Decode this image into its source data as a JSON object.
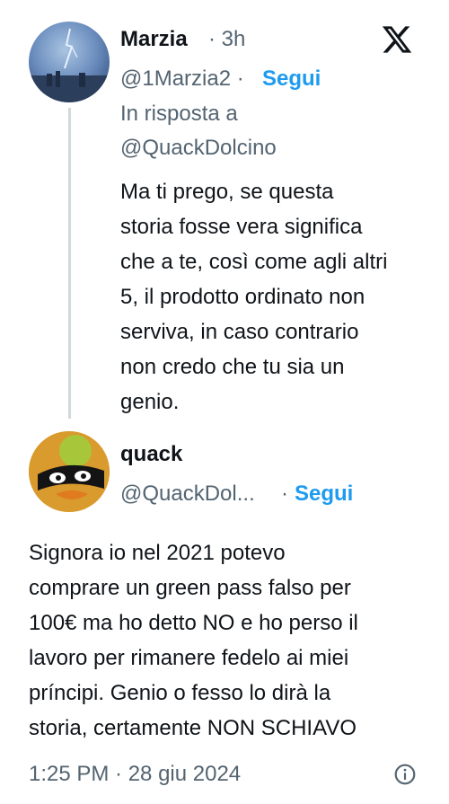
{
  "post1": {
    "name": "Marzia",
    "time": "· 3h",
    "handle": "@1Marzia2 ·",
    "follow_label": "Segui",
    "reply_to_label": "In risposta a",
    "reply_to_handle": "@QuackDolcino",
    "text_lines": [
      "Ma ti prego, se questa",
      "storia fosse vera significa",
      "che a te, così come agli altri",
      "5, il prodotto ordinato non",
      "serviva, in caso contrario",
      "non credo che tu sia un",
      "genio."
    ]
  },
  "post2": {
    "name": "quack",
    "handle": "@QuackDol...",
    "separator": "·",
    "follow_label": "Segui",
    "text_lines": [
      "Signora io nel 2021 potevo",
      "comprare un green pass falso per",
      "100€ ma ho detto NO e ho perso il",
      "lavoro per rimanere fedelo ai miei",
      "príncipi. Genio o fesso lo dirà la",
      "storia, certamente NON SCHIAVO"
    ],
    "timestamp": "1:25 PM · 28 giu 2024"
  },
  "icons": {
    "logo": "x-logo-icon",
    "info": "info-icon"
  },
  "colors": {
    "accent": "#1d9bf0",
    "muted": "#536471",
    "text": "#0f1419",
    "thread_line": "#cfd9de"
  }
}
